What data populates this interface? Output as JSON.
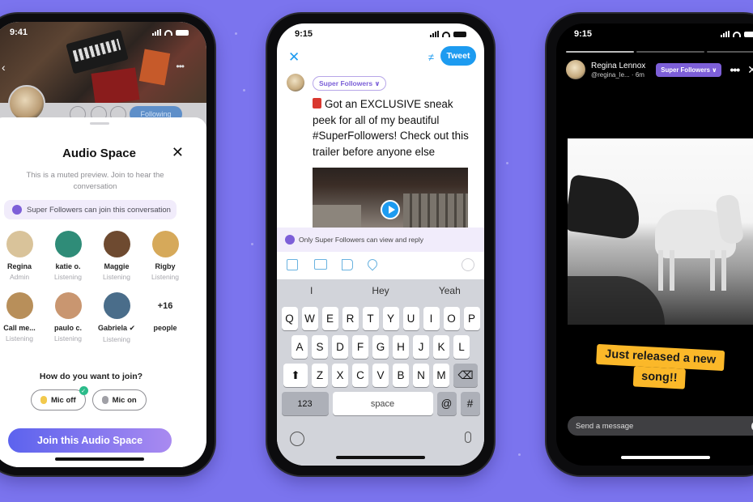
{
  "background_color": "#7b74ee",
  "phone1": {
    "status_time": "9:41",
    "hero": {
      "back_icon": "chevron-left-icon",
      "more_icon": "more-icon",
      "following_label": "Following"
    },
    "sheet": {
      "title": "Audio Space",
      "close_icon": "✕",
      "subtitle": "This is a muted preview. Join to hear the conversation",
      "restriction": "Super Followers can join this conversation",
      "listeners": [
        {
          "name": "Regina",
          "role": "Admin",
          "color": "#d9c39a"
        },
        {
          "name": "katie o.",
          "role": "Listening",
          "color": "#2f8c78"
        },
        {
          "name": "Maggie",
          "role": "Listening",
          "color": "#6e4a30"
        },
        {
          "name": "Rigby",
          "role": "Listening",
          "color": "#d6a95a"
        },
        {
          "name": "Call me...",
          "role": "Listening",
          "color": "#b88f5a"
        },
        {
          "name": "paulo c.",
          "role": "Listening",
          "color": "#c99670"
        },
        {
          "name": "Gabriela ✔",
          "role": "Listening",
          "color": "#4a6d8a"
        }
      ],
      "more_count": "+16",
      "more_label": "people",
      "join_question": "How do you want to join?",
      "mic_off_label": "Mic off",
      "mic_on_label": "Mic on",
      "mic_off_selected": true,
      "join_button": "Join this Audio Space",
      "accent": "#7d5fd8"
    }
  },
  "phone2": {
    "status_time": "9:15",
    "close_icon": "✕",
    "tweet_button": "Tweet",
    "audience_label": "Super Followers ∨",
    "tweet_text": "Got an EXCLUSIVE sneak peek for all of my beautiful #SuperFollowers! Check out this trailer before anyone else",
    "restriction": "Only Super Followers can view and reply",
    "toolbar_icons": [
      "image-icon",
      "gif-icon",
      "poll-icon",
      "location-icon"
    ],
    "suggestions": [
      "I",
      "Hey",
      "Yeah"
    ],
    "keyboard": {
      "row1": [
        "Q",
        "W",
        "E",
        "R",
        "T",
        "Y",
        "U",
        "I",
        "O",
        "P"
      ],
      "row2": [
        "A",
        "S",
        "D",
        "F",
        "G",
        "H",
        "J",
        "K",
        "L"
      ],
      "row3": [
        "Z",
        "X",
        "C",
        "V",
        "B",
        "N",
        "M"
      ],
      "shift": "⬆",
      "backspace": "⌫",
      "numbers": "123",
      "space": "space",
      "at": "@",
      "hash": "#"
    },
    "accent": "#1d9bf0"
  },
  "phone3": {
    "status_time": "9:15",
    "user_name": "Regina Lennox",
    "user_handle": "@regina_le... · 6m",
    "audience_label": "Super Followers ∨",
    "more_icon": "•••",
    "close_icon": "✕",
    "sticker_line1": "Just released a new",
    "sticker_line2": "song!!",
    "message_placeholder": "Send a message",
    "progress_segments_done": 1,
    "progress_segments_total": 3
  }
}
